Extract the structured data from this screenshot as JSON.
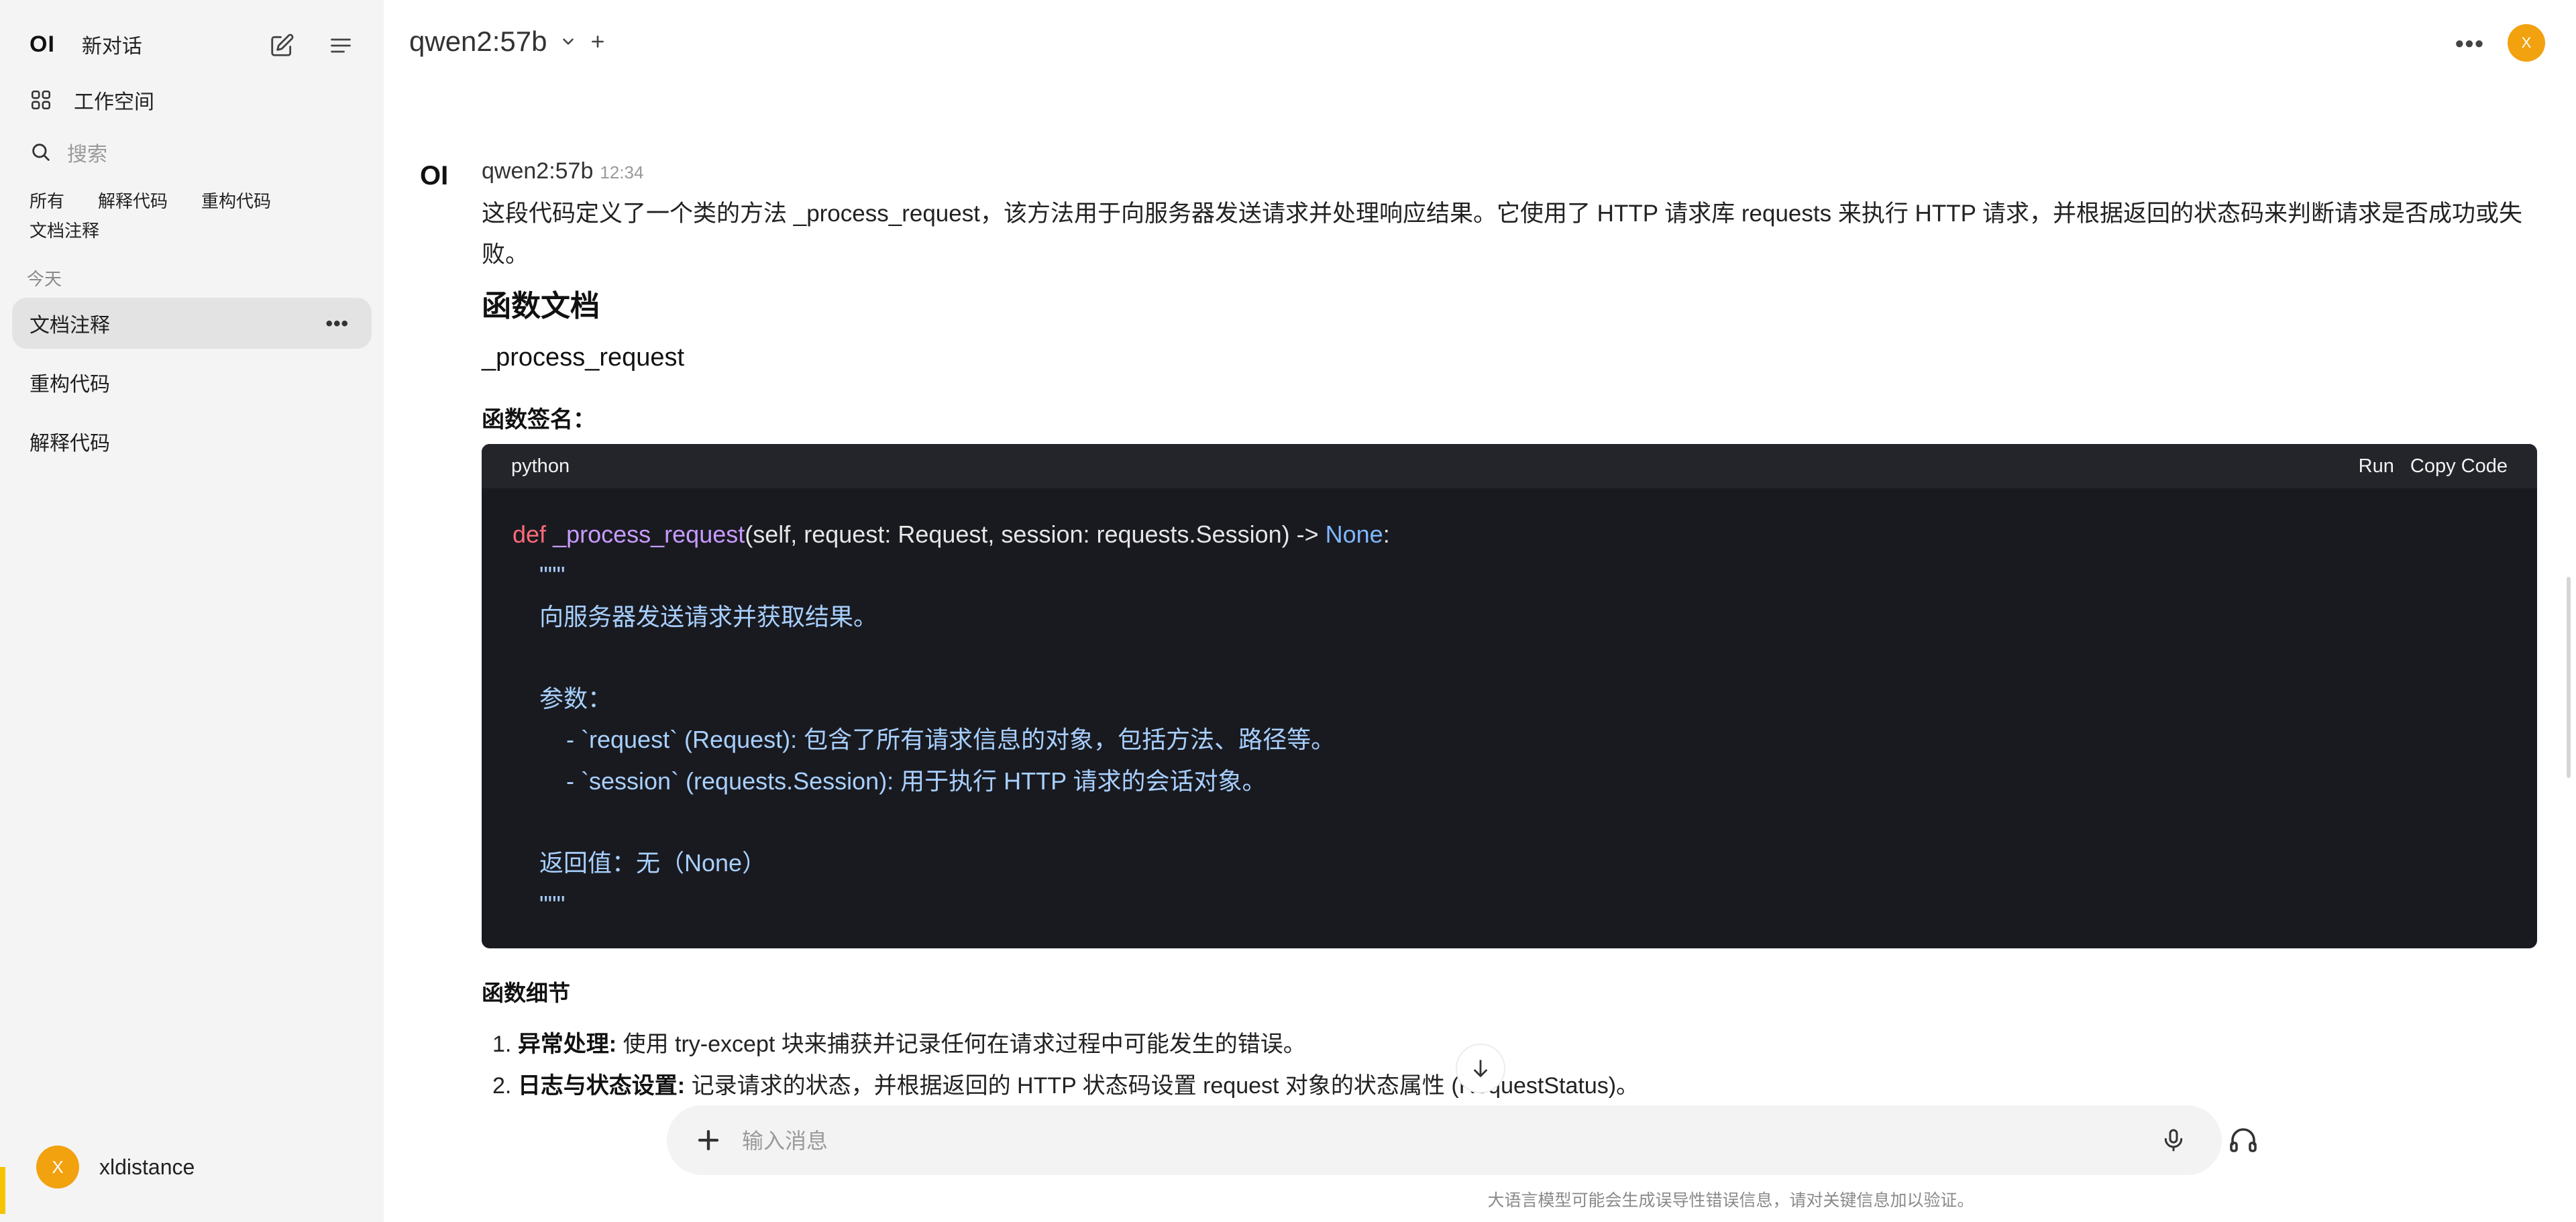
{
  "sidebar": {
    "logo": "OI",
    "new_chat": "新对话",
    "workspace": "工作空间",
    "search_placeholder": "搜索",
    "tags": [
      "所有",
      "解释代码",
      "重构代码",
      "文档注释"
    ],
    "section_today": "今天",
    "chats": [
      "文档注释",
      "重构代码",
      "解释代码"
    ],
    "user_initial": "X",
    "user_name": "xldistance"
  },
  "header": {
    "model": "qwen2:57b",
    "user_initial": "X"
  },
  "message": {
    "logo": "OI",
    "model": "qwen2:57b",
    "time": "12:34",
    "intro": "这段代码定义了一个类的方法 _process_request，该方法用于向服务器发送请求并处理响应结果。它使用了 HTTP 请求库 requests 来执行 HTTP 请求，并根据返回的状态码来判断请求是否成功或失败。",
    "heading": "函数文档",
    "fn_name": "_process_request",
    "sig_label": "函数签名：",
    "code": {
      "lang": "python",
      "run": "Run",
      "copy": "Copy Code",
      "def_kw": "def",
      "def_name": "_process_request",
      "def_args": "(self, request: Request, session: requests.Session) -> ",
      "def_ret": "None",
      "def_colon": ":",
      "doc_open": "    \"\"\"",
      "doc_1": "    向服务器发送请求并获取结果。",
      "doc_2": "    参数：",
      "doc_3": "        - `request` (Request): 包含了所有请求信息的对象，包括方法、路径等。",
      "doc_4": "        - `session` (requests.Session): 用于执行 HTTP 请求的会话对象。",
      "doc_5": "    返回值：无（None）",
      "doc_close": "    \"\"\""
    },
    "detail_heading": "函数细节",
    "details": [
      {
        "num": "1.",
        "title": "异常处理:",
        "text": " 使用 try-except 块来捕获并记录任何在请求过程中可能发生的错误。"
      },
      {
        "num": "2.",
        "title": "日志与状态设置:",
        "text": " 记录请求的状态，并根据返回的 HTTP 状态码设置 request 对象的状态属性 (RequestStatus)。"
      }
    ]
  },
  "input": {
    "placeholder": "输入消息"
  },
  "disclaimer": "大语言模型可能会生成误导性错误信息，请对关键信息加以验证。",
  "colors": {
    "avatar": "#f2a10f",
    "code_bg": "#191a20",
    "keyword": "#ff6a78",
    "function": "#c89bff",
    "docstring": "#a8d0ff"
  }
}
